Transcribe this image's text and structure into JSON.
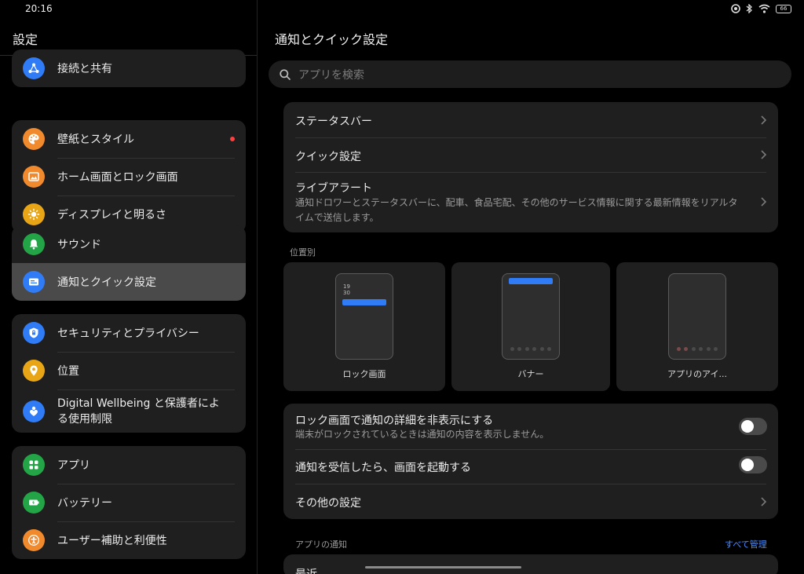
{
  "status": {
    "time": "20:16",
    "battery": "66"
  },
  "left": {
    "title": "設定",
    "groups": [
      {
        "items": [
          {
            "label": "接続と共有"
          }
        ]
      },
      {
        "items": [
          {
            "label": "壁紙とスタイル"
          },
          {
            "label": "ホーム画面とロック画面"
          },
          {
            "label": "ディスプレイと明るさ"
          }
        ]
      },
      {
        "items": [
          {
            "label": "サウンド"
          },
          {
            "label": "通知とクイック設定"
          }
        ]
      },
      {
        "items": [
          {
            "label": "セキュリティとプライバシー"
          },
          {
            "label": "位置"
          },
          {
            "label": "Digital Wellbeing と保護者による使用制限"
          }
        ]
      },
      {
        "items": [
          {
            "label": "アプリ"
          },
          {
            "label": "バッテリー"
          },
          {
            "label": "ユーザー補助と利便性"
          }
        ]
      }
    ],
    "colors": {
      "blue": "#2f7cf6",
      "orange": "#f08a2c",
      "yellow": "#e8a617",
      "green": "#22a447",
      "badge": "#ff4040"
    }
  },
  "right": {
    "title": "通知とクイック設定",
    "search_placeholder": "アプリを検索",
    "top_rows": [
      {
        "title": "ステータスバー"
      },
      {
        "title": "クイック設定"
      },
      {
        "title": "ライブアラート",
        "sub": "通知ドロワーとステータスバーに、配車、食品宅配、その他のサービス情報に関する最新情報をリアルタイムで送信します。"
      }
    ],
    "position_section": "位置別",
    "tiles": [
      {
        "label": "ロック画面",
        "clock_h": "19",
        "clock_m": "30"
      },
      {
        "label": "バナー"
      },
      {
        "label": "アプリのアイ..."
      }
    ],
    "settings_rows": [
      {
        "title": "ロック画面で通知の詳細を非表示にする",
        "sub": "端末がロックされているときは通知の内容を表示しません。",
        "toggle": false
      },
      {
        "title": "通知を受信したら、画面を起動する",
        "toggle": false
      },
      {
        "title": "その他の設定"
      }
    ],
    "app_notif_section": "アプリの通知",
    "manage_all": "すべて管理",
    "recent_label": "最近"
  }
}
